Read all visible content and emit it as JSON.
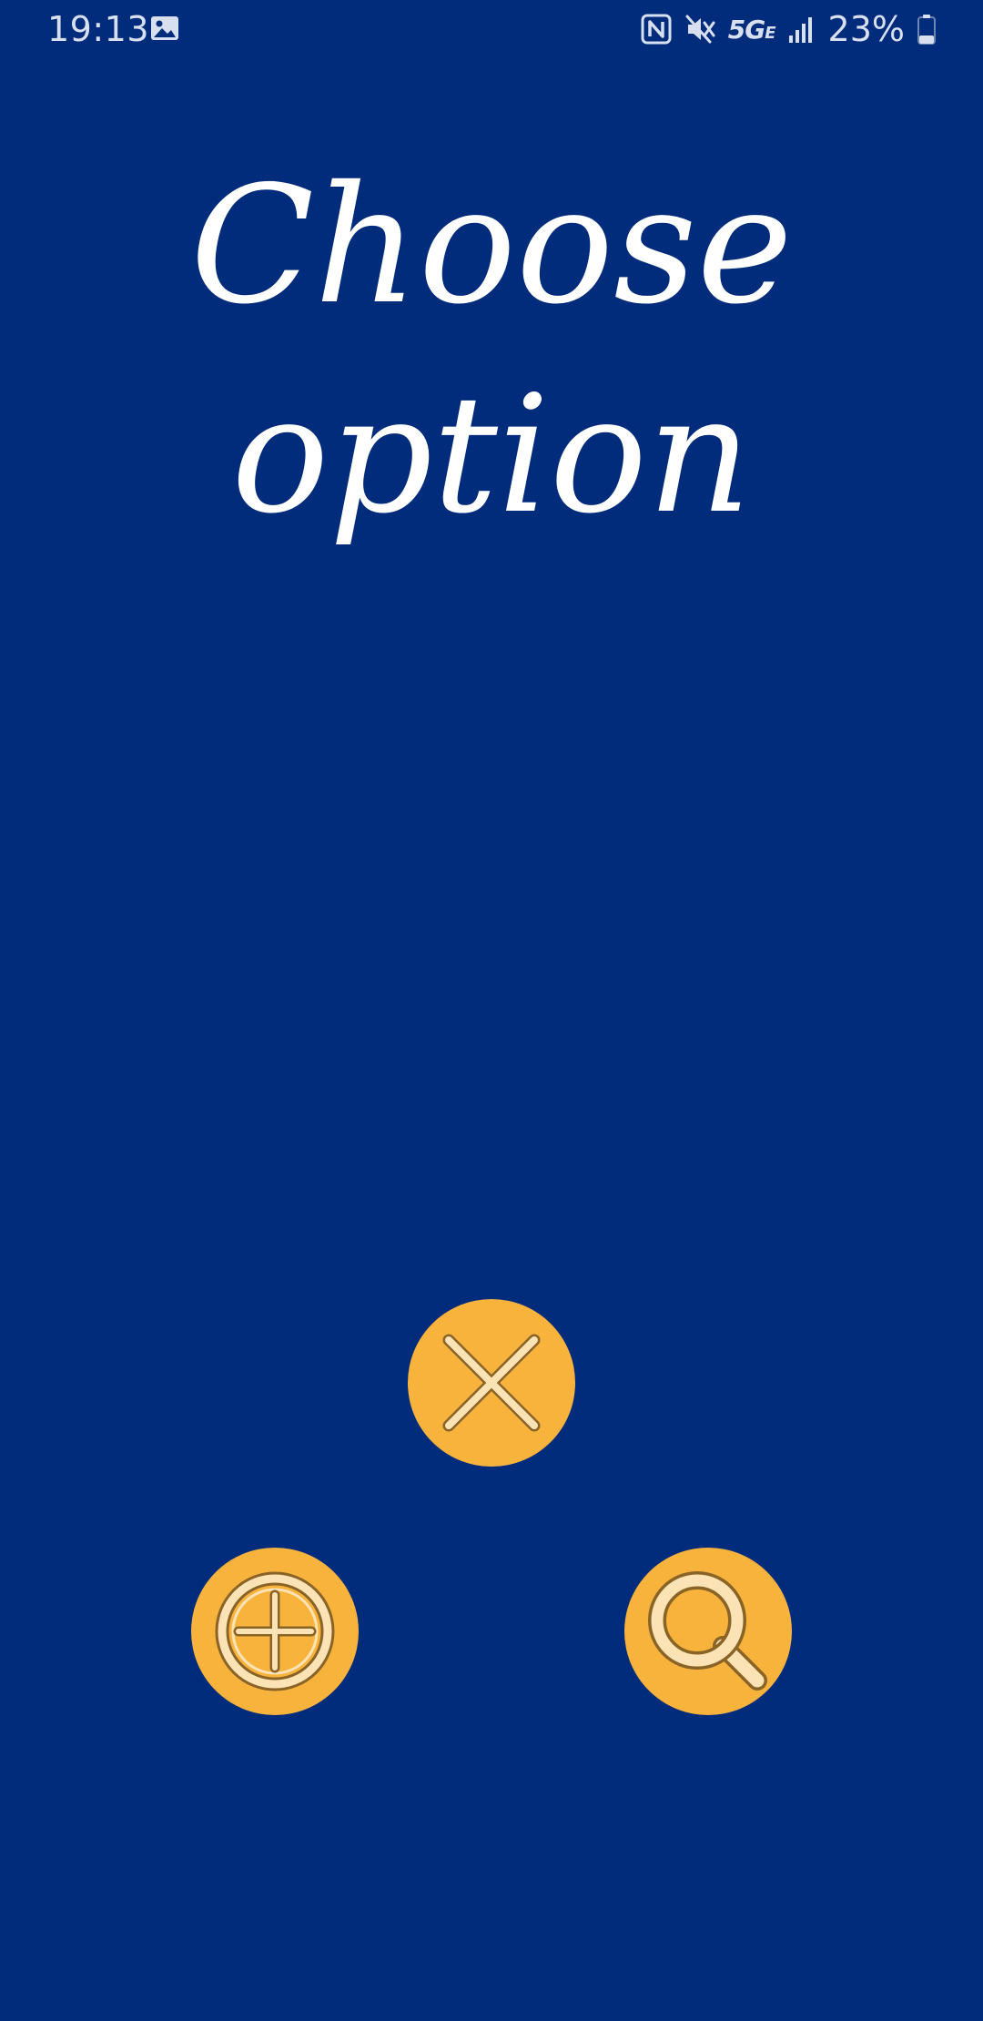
{
  "status_bar": {
    "time": "19:13",
    "battery_percent": "23%",
    "network": "5G",
    "network_suffix": "E",
    "icons": [
      "gallery-icon",
      "nfc-icon",
      "mute-icon",
      "signal-icon",
      "battery-icon"
    ]
  },
  "main": {
    "title": "Choose option"
  },
  "actions": [
    {
      "name": "close",
      "icon": "close-icon"
    },
    {
      "name": "add",
      "icon": "add-circle-icon"
    },
    {
      "name": "search",
      "icon": "search-icon"
    }
  ],
  "colors": {
    "background": "#012b7b",
    "button_fill": "#f8b33d",
    "icon_fill": "#fbe3b6",
    "icon_outline": "#8a6426",
    "title_text": "#ffffff",
    "status_text": "#d8e0f0"
  }
}
